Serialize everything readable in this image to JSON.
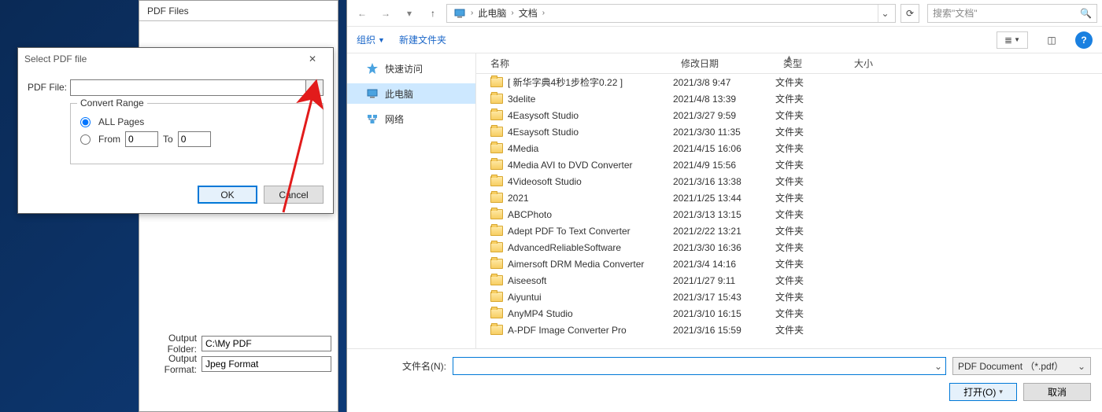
{
  "app": {
    "group_title": "PDF Files",
    "output_folder_label": "Output Folder:",
    "output_folder_value": "C:\\My PDF",
    "output_format_label": "Output Format:",
    "output_format_value": "Jpeg Format"
  },
  "select_dialog": {
    "title": "Select PDF file",
    "pdf_file_label": "PDF File:",
    "pdf_file_value": "",
    "browse_label": "...",
    "range_legend": "Convert Range",
    "all_pages_label": "ALL Pages",
    "from_label": "From",
    "to_label": "To",
    "from_value": "0",
    "to_value": "0",
    "ok_label": "OK",
    "cancel_label": "Cancel"
  },
  "open_dialog": {
    "breadcrumb": {
      "root_icon": "pc",
      "seg1": "此电脑",
      "seg2": "文档"
    },
    "search_placeholder": "搜索\"文档\"",
    "toolbar": {
      "organize": "组织",
      "new_folder": "新建文件夹"
    },
    "nav": {
      "quick": "快速访问",
      "this_pc": "此电脑",
      "network": "网络"
    },
    "columns": {
      "name": "名称",
      "date": "修改日期",
      "type": "类型",
      "size": "大小"
    },
    "rows": [
      {
        "name": "[ 新华字典4秒1步检字0.22 ]",
        "date": "2021/3/8 9:47",
        "type": "文件夹"
      },
      {
        "name": "3delite",
        "date": "2021/4/8 13:39",
        "type": "文件夹"
      },
      {
        "name": "4Easysoft Studio",
        "date": "2021/3/27 9:59",
        "type": "文件夹"
      },
      {
        "name": "4Esaysoft Studio",
        "date": "2021/3/30 11:35",
        "type": "文件夹"
      },
      {
        "name": "4Media",
        "date": "2021/4/15 16:06",
        "type": "文件夹"
      },
      {
        "name": "4Media AVI to DVD Converter",
        "date": "2021/4/9 15:56",
        "type": "文件夹"
      },
      {
        "name": "4Videosoft Studio",
        "date": "2021/3/16 13:38",
        "type": "文件夹"
      },
      {
        "name": "2021",
        "date": "2021/1/25 13:44",
        "type": "文件夹"
      },
      {
        "name": "ABCPhoto",
        "date": "2021/3/13 13:15",
        "type": "文件夹"
      },
      {
        "name": "Adept PDF To Text Converter",
        "date": "2021/2/22 13:21",
        "type": "文件夹"
      },
      {
        "name": "AdvancedReliableSoftware",
        "date": "2021/3/30 16:36",
        "type": "文件夹"
      },
      {
        "name": "Aimersoft DRM Media Converter",
        "date": "2021/3/4 14:16",
        "type": "文件夹"
      },
      {
        "name": "Aiseesoft",
        "date": "2021/1/27 9:11",
        "type": "文件夹"
      },
      {
        "name": "Aiyuntui",
        "date": "2021/3/17 15:43",
        "type": "文件夹"
      },
      {
        "name": "AnyMP4 Studio",
        "date": "2021/3/10 16:15",
        "type": "文件夹"
      },
      {
        "name": "A-PDF Image Converter Pro",
        "date": "2021/3/16 15:59",
        "type": "文件夹"
      }
    ],
    "filename_label": "文件名(N):",
    "filename_value": "",
    "filter_label": "PDF Document （*.pdf）",
    "open_button": "打开(O)",
    "cancel_button": "取消"
  }
}
